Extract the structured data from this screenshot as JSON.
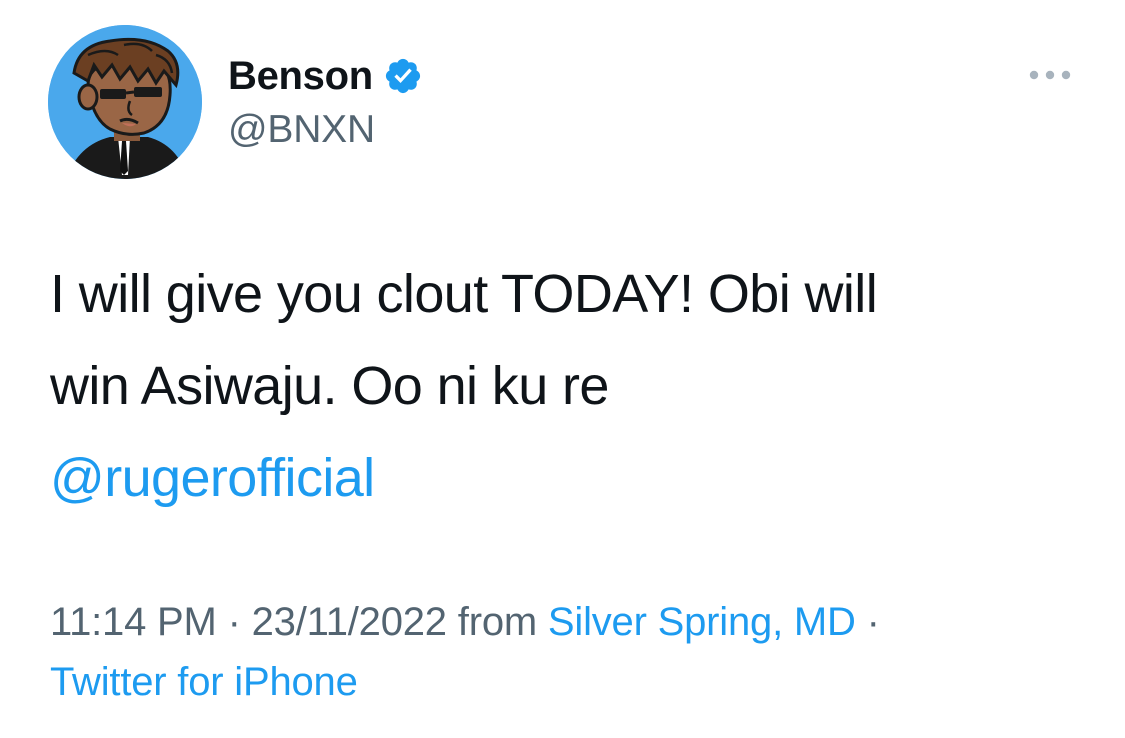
{
  "author": {
    "display_name": "Benson",
    "handle": "@BNXN",
    "verified": true
  },
  "tweet": {
    "text_line_1": "I will give you clout TODAY! Obi will",
    "text_line_2": "win Asiwaju. Oo ni ku re",
    "mention": "@rugerofficial"
  },
  "meta": {
    "time": "11:14 PM",
    "separator": "·",
    "date": "23/11/2022",
    "from_label": "from",
    "location": "Silver Spring, MD",
    "source": "Twitter for iPhone"
  },
  "icons": {
    "verified": "verified-badge-icon",
    "more": "more-options-icon"
  },
  "colors": {
    "link": "#1d9bf0",
    "verified": "#1d9bf0",
    "avatar_background": "#4aa8ec",
    "secondary_text": "#536471",
    "primary_text": "#0f1419"
  }
}
